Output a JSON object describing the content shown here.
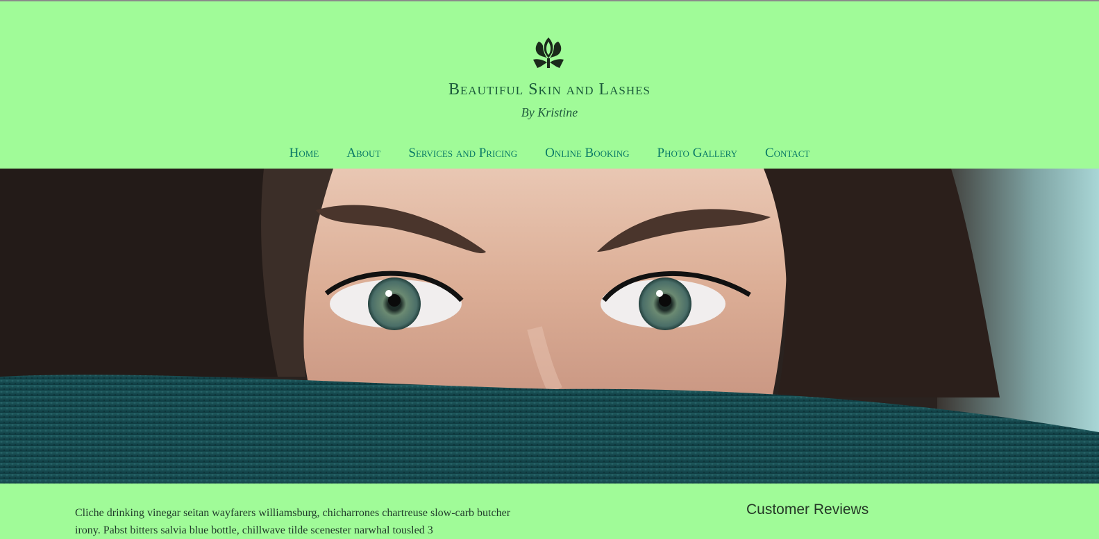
{
  "header": {
    "logo_icon": "flower-ornament-icon",
    "title": "Beautiful Skin and Lashes",
    "subtitle": "By Kristine"
  },
  "nav": {
    "items": [
      {
        "label": "Home"
      },
      {
        "label": "About"
      },
      {
        "label": "Services and Pricing"
      },
      {
        "label": "Online Booking"
      },
      {
        "label": "Photo Gallery"
      },
      {
        "label": "Contact"
      }
    ]
  },
  "hero": {
    "image": "woman-eyes-photo"
  },
  "content": {
    "intro_text": "Cliche drinking vinegar seitan wayfarers williamsburg, chicharrones chartreuse slow-carb butcher irony. Pabst bitters salvia blue bottle, chillwave tilde scenester narwhal tousled 3",
    "reviews_title": "Customer Reviews"
  },
  "colors": {
    "background": "#a0fb98",
    "nav_link": "#0a7a66",
    "title": "#1a5a3a"
  }
}
